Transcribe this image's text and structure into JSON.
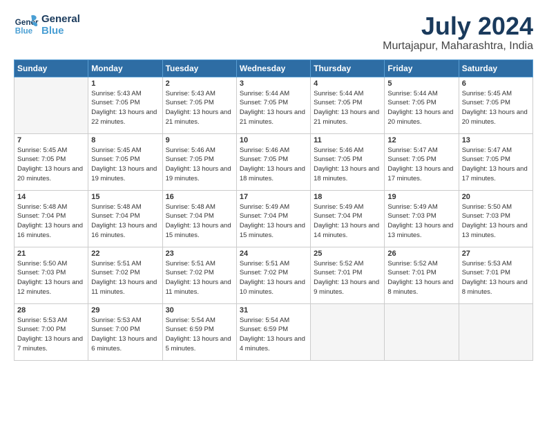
{
  "header": {
    "logo_line1": "General",
    "logo_line2": "Blue",
    "month_title": "July 2024",
    "location": "Murtajapur, Maharashtra, India"
  },
  "days_of_week": [
    "Sunday",
    "Monday",
    "Tuesday",
    "Wednesday",
    "Thursday",
    "Friday",
    "Saturday"
  ],
  "weeks": [
    [
      {
        "day": "",
        "empty": true
      },
      {
        "day": "1",
        "sunrise": "5:43 AM",
        "sunset": "7:05 PM",
        "daylight": "13 hours and 22 minutes."
      },
      {
        "day": "2",
        "sunrise": "5:43 AM",
        "sunset": "7:05 PM",
        "daylight": "13 hours and 21 minutes."
      },
      {
        "day": "3",
        "sunrise": "5:44 AM",
        "sunset": "7:05 PM",
        "daylight": "13 hours and 21 minutes."
      },
      {
        "day": "4",
        "sunrise": "5:44 AM",
        "sunset": "7:05 PM",
        "daylight": "13 hours and 21 minutes."
      },
      {
        "day": "5",
        "sunrise": "5:44 AM",
        "sunset": "7:05 PM",
        "daylight": "13 hours and 20 minutes."
      },
      {
        "day": "6",
        "sunrise": "5:45 AM",
        "sunset": "7:05 PM",
        "daylight": "13 hours and 20 minutes."
      }
    ],
    [
      {
        "day": "7",
        "sunrise": "5:45 AM",
        "sunset": "7:05 PM",
        "daylight": "13 hours and 20 minutes."
      },
      {
        "day": "8",
        "sunrise": "5:45 AM",
        "sunset": "7:05 PM",
        "daylight": "13 hours and 19 minutes."
      },
      {
        "day": "9",
        "sunrise": "5:46 AM",
        "sunset": "7:05 PM",
        "daylight": "13 hours and 19 minutes."
      },
      {
        "day": "10",
        "sunrise": "5:46 AM",
        "sunset": "7:05 PM",
        "daylight": "13 hours and 18 minutes."
      },
      {
        "day": "11",
        "sunrise": "5:46 AM",
        "sunset": "7:05 PM",
        "daylight": "13 hours and 18 minutes."
      },
      {
        "day": "12",
        "sunrise": "5:47 AM",
        "sunset": "7:05 PM",
        "daylight": "13 hours and 17 minutes."
      },
      {
        "day": "13",
        "sunrise": "5:47 AM",
        "sunset": "7:05 PM",
        "daylight": "13 hours and 17 minutes."
      }
    ],
    [
      {
        "day": "14",
        "sunrise": "5:48 AM",
        "sunset": "7:04 PM",
        "daylight": "13 hours and 16 minutes."
      },
      {
        "day": "15",
        "sunrise": "5:48 AM",
        "sunset": "7:04 PM",
        "daylight": "13 hours and 16 minutes."
      },
      {
        "day": "16",
        "sunrise": "5:48 AM",
        "sunset": "7:04 PM",
        "daylight": "13 hours and 15 minutes."
      },
      {
        "day": "17",
        "sunrise": "5:49 AM",
        "sunset": "7:04 PM",
        "daylight": "13 hours and 15 minutes."
      },
      {
        "day": "18",
        "sunrise": "5:49 AM",
        "sunset": "7:04 PM",
        "daylight": "13 hours and 14 minutes."
      },
      {
        "day": "19",
        "sunrise": "5:49 AM",
        "sunset": "7:03 PM",
        "daylight": "13 hours and 13 minutes."
      },
      {
        "day": "20",
        "sunrise": "5:50 AM",
        "sunset": "7:03 PM",
        "daylight": "13 hours and 13 minutes."
      }
    ],
    [
      {
        "day": "21",
        "sunrise": "5:50 AM",
        "sunset": "7:03 PM",
        "daylight": "13 hours and 12 minutes."
      },
      {
        "day": "22",
        "sunrise": "5:51 AM",
        "sunset": "7:02 PM",
        "daylight": "13 hours and 11 minutes."
      },
      {
        "day": "23",
        "sunrise": "5:51 AM",
        "sunset": "7:02 PM",
        "daylight": "13 hours and 11 minutes."
      },
      {
        "day": "24",
        "sunrise": "5:51 AM",
        "sunset": "7:02 PM",
        "daylight": "13 hours and 10 minutes."
      },
      {
        "day": "25",
        "sunrise": "5:52 AM",
        "sunset": "7:01 PM",
        "daylight": "13 hours and 9 minutes."
      },
      {
        "day": "26",
        "sunrise": "5:52 AM",
        "sunset": "7:01 PM",
        "daylight": "13 hours and 8 minutes."
      },
      {
        "day": "27",
        "sunrise": "5:53 AM",
        "sunset": "7:01 PM",
        "daylight": "13 hours and 8 minutes."
      }
    ],
    [
      {
        "day": "28",
        "sunrise": "5:53 AM",
        "sunset": "7:00 PM",
        "daylight": "13 hours and 7 minutes."
      },
      {
        "day": "29",
        "sunrise": "5:53 AM",
        "sunset": "7:00 PM",
        "daylight": "13 hours and 6 minutes."
      },
      {
        "day": "30",
        "sunrise": "5:54 AM",
        "sunset": "6:59 PM",
        "daylight": "13 hours and 5 minutes."
      },
      {
        "day": "31",
        "sunrise": "5:54 AM",
        "sunset": "6:59 PM",
        "daylight": "13 hours and 4 minutes."
      },
      {
        "day": "",
        "empty": true
      },
      {
        "day": "",
        "empty": true
      },
      {
        "day": "",
        "empty": true
      }
    ]
  ]
}
